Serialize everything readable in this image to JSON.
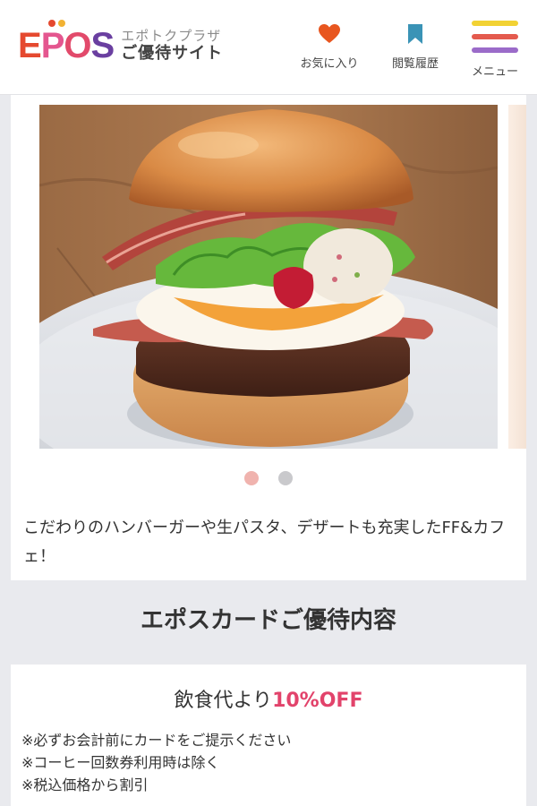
{
  "header": {
    "logo_letters": [
      "E",
      "P",
      "O",
      "S"
    ],
    "logo_sub": "エポトクプラザ",
    "logo_main": "ご優待サイト",
    "favorites_label": "お気に入り",
    "history_label": "閲覧履歴",
    "menu_label": "メニュー",
    "icons": {
      "favorites": "heart-icon",
      "history": "bookmark-icon",
      "menu": "hamburger-menu-icon"
    }
  },
  "colors": {
    "heart": "#e8561f",
    "bookmark": "#3a93b6",
    "menu_lines": [
      "#f2d234",
      "#e45a4e",
      "#9b6bc9"
    ],
    "accent": "#e2436b"
  },
  "slider": {
    "image_alt": "hamburger-photo",
    "description": "こだわりのハンバーガーや生パスタ、デザートも充実したFF&カフェ！",
    "dots": [
      {
        "state": "active"
      },
      {
        "state": "inactive"
      }
    ]
  },
  "benefit": {
    "section_title": "エポスカードご優待内容",
    "headline_prefix": "飲食代より",
    "headline_highlight": "10%OFF",
    "notes": [
      "※必ずお会計前にカードをご提示ください",
      "※コーヒー回数券利用時は除く",
      "※税込価格から割引"
    ]
  }
}
